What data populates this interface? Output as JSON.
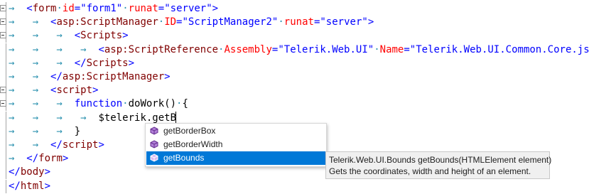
{
  "editor": {
    "lines": [
      {
        "fold": true,
        "tokens": [
          {
            "t": "ws",
            "v": "→  "
          },
          {
            "t": "punc",
            "v": "<"
          },
          {
            "t": "tag",
            "v": "form"
          },
          {
            "t": "ws",
            "v": "·"
          },
          {
            "t": "attr",
            "v": "id"
          },
          {
            "t": "punc",
            "v": "="
          },
          {
            "t": "val",
            "v": "\"form1\""
          },
          {
            "t": "ws",
            "v": "·"
          },
          {
            "t": "attr",
            "v": "runat"
          },
          {
            "t": "punc",
            "v": "="
          },
          {
            "t": "val",
            "v": "\"server\""
          },
          {
            "t": "punc",
            "v": ">"
          }
        ]
      },
      {
        "fold": true,
        "tokens": [
          {
            "t": "ws",
            "v": "→   →  "
          },
          {
            "t": "punc",
            "v": "<"
          },
          {
            "t": "tag",
            "v": "asp:ScriptManager"
          },
          {
            "t": "ws",
            "v": "·"
          },
          {
            "t": "attr",
            "v": "ID"
          },
          {
            "t": "punc",
            "v": "="
          },
          {
            "t": "val",
            "v": "\"ScriptManager2\""
          },
          {
            "t": "ws",
            "v": "·"
          },
          {
            "t": "attr",
            "v": "runat"
          },
          {
            "t": "punc",
            "v": "="
          },
          {
            "t": "val",
            "v": "\"server\""
          },
          {
            "t": "punc",
            "v": ">"
          }
        ]
      },
      {
        "fold": true,
        "tokens": [
          {
            "t": "ws",
            "v": "→   →   →  "
          },
          {
            "t": "punc",
            "v": "<"
          },
          {
            "t": "tag",
            "v": "Scripts"
          },
          {
            "t": "punc",
            "v": ">"
          }
        ]
      },
      {
        "fold": false,
        "tokens": [
          {
            "t": "ws",
            "v": "→   →   →   →  "
          },
          {
            "t": "punc",
            "v": "<"
          },
          {
            "t": "tag",
            "v": "asp:ScriptReference"
          },
          {
            "t": "ws",
            "v": "·"
          },
          {
            "t": "attr",
            "v": "Assembly"
          },
          {
            "t": "punc",
            "v": "="
          },
          {
            "t": "val",
            "v": "\"Telerik.Web.UI\""
          },
          {
            "t": "ws",
            "v": "·"
          },
          {
            "t": "attr",
            "v": "Name"
          },
          {
            "t": "punc",
            "v": "="
          },
          {
            "t": "val",
            "v": "\"Telerik.Web.UI.Common.Core.js\""
          },
          {
            "t": "ws",
            "v": "·"
          },
          {
            "t": "punc",
            "v": "/>"
          }
        ]
      },
      {
        "fold": false,
        "tokens": [
          {
            "t": "ws",
            "v": "→   →   →  "
          },
          {
            "t": "punc",
            "v": "</"
          },
          {
            "t": "tag",
            "v": "Scripts"
          },
          {
            "t": "punc",
            "v": ">"
          }
        ]
      },
      {
        "fold": false,
        "tokens": [
          {
            "t": "ws",
            "v": "→   →  "
          },
          {
            "t": "punc",
            "v": "</"
          },
          {
            "t": "tag",
            "v": "asp:ScriptManager"
          },
          {
            "t": "punc",
            "v": ">"
          }
        ]
      },
      {
        "fold": true,
        "tokens": [
          {
            "t": "ws",
            "v": "→   →  "
          },
          {
            "t": "punc",
            "v": "<"
          },
          {
            "t": "tag",
            "v": "script"
          },
          {
            "t": "punc",
            "v": ">"
          }
        ]
      },
      {
        "fold": true,
        "tokens": [
          {
            "t": "ws",
            "v": "→   →   →  "
          },
          {
            "t": "kw",
            "v": "function"
          },
          {
            "t": "ws",
            "v": "·"
          },
          {
            "t": "plain",
            "v": "doWork()"
          },
          {
            "t": "ws",
            "v": "·"
          },
          {
            "t": "plain",
            "v": "{"
          }
        ]
      },
      {
        "fold": false,
        "tokens": [
          {
            "t": "ws",
            "v": "→   →   →   →  "
          },
          {
            "t": "plain",
            "v": "$telerik.getB"
          }
        ]
      },
      {
        "fold": false,
        "tokens": [
          {
            "t": "ws",
            "v": "→   →   →  "
          },
          {
            "t": "plain",
            "v": "}"
          }
        ]
      },
      {
        "fold": false,
        "tokens": [
          {
            "t": "ws",
            "v": "→   →  "
          },
          {
            "t": "punc",
            "v": "</"
          },
          {
            "t": "tag",
            "v": "script"
          },
          {
            "t": "punc",
            "v": ">"
          }
        ]
      },
      {
        "fold": false,
        "tokens": [
          {
            "t": "ws",
            "v": "→  "
          },
          {
            "t": "punc",
            "v": "</"
          },
          {
            "t": "tag",
            "v": "form"
          },
          {
            "t": "punc",
            "v": ">"
          }
        ]
      },
      {
        "fold": false,
        "tokens": [
          {
            "t": "punc",
            "v": "</"
          },
          {
            "t": "tag",
            "v": "body"
          },
          {
            "t": "punc",
            "v": ">"
          }
        ]
      },
      {
        "fold": false,
        "tokens": [
          {
            "t": "punc",
            "v": "</"
          },
          {
            "t": "tag",
            "v": "html"
          },
          {
            "t": "punc",
            "v": ">"
          }
        ]
      }
    ]
  },
  "completion": {
    "icon": "method-cube-icon",
    "items": [
      {
        "label": "getBorderBox",
        "selected": false
      },
      {
        "label": "getBorderWidth",
        "selected": false
      },
      {
        "label": "getBounds",
        "selected": true
      }
    ]
  },
  "tooltip": {
    "signature": "Telerik.Web.UI.Bounds getBounds(HTMLElement element)",
    "description": "Gets the coordinates, width and height of an element."
  },
  "colors": {
    "tag": "#800000",
    "attribute": "#ff0000",
    "value": "#0000ff",
    "whitespace": "#2b91af",
    "selection": "#0078d7"
  }
}
